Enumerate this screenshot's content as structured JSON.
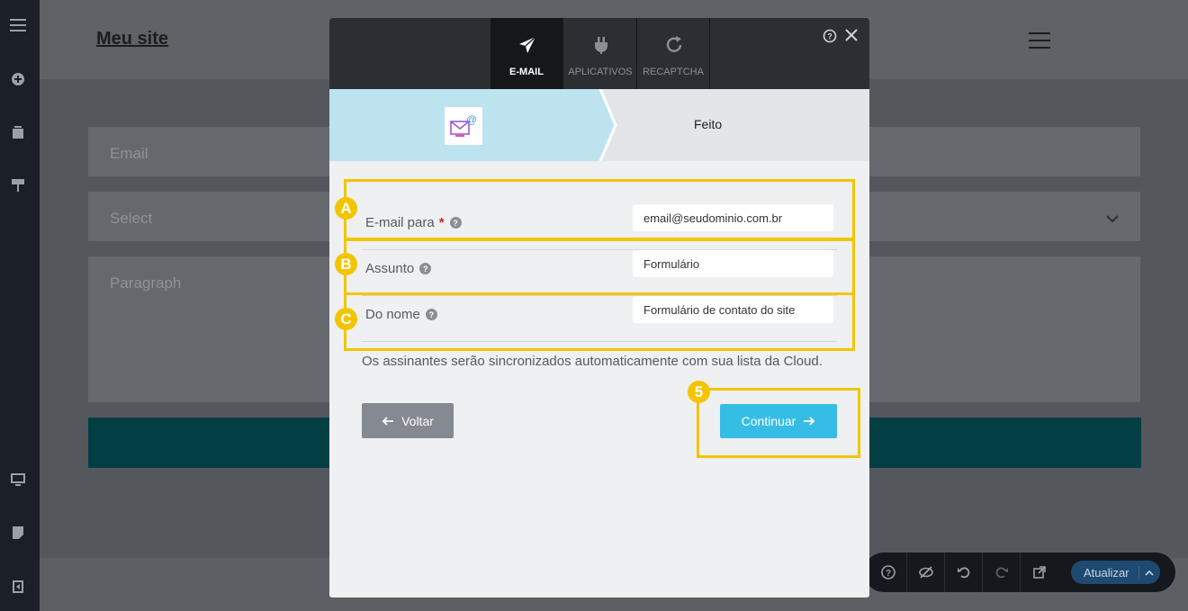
{
  "page": {
    "site_title": "Meu site",
    "fields": {
      "email_placeholder": "Email",
      "select_placeholder": "Select",
      "paragraph_placeholder": "Paragraph"
    }
  },
  "toolbar": {
    "update_label": "Atualizar"
  },
  "modal": {
    "tabs": [
      {
        "label": "E-MAIL",
        "icon": "paper-plane-icon",
        "active": true
      },
      {
        "label": "APLICATIVOS",
        "icon": "plug-icon",
        "active": false
      },
      {
        "label": "RECAPTCHA",
        "icon": "refresh-icon",
        "active": false
      }
    ],
    "steps": {
      "step1_icon": "email-at-icon",
      "step2_label": "Feito"
    },
    "form": {
      "email_to": {
        "label": "E-mail para",
        "required_mark": "*",
        "value": "email@seudominio.com.br"
      },
      "subject": {
        "label": "Assunto",
        "value": "Formulário"
      },
      "from_name": {
        "label": "Do nome",
        "value": "Formulário de contato do site"
      }
    },
    "hint": "Os assinantes serão sincronizados automaticamente com sua lista da Cloud.",
    "back_label": "Voltar",
    "continue_label": "Continuar"
  },
  "annotations": {
    "marker_a": "A",
    "marker_b": "B",
    "marker_c": "C",
    "marker_5": "5"
  },
  "colors": {
    "accent": "#36bde6",
    "highlight": "#f2c500",
    "step_active": "#bde3ef",
    "modal_header": "#2b2e33"
  }
}
